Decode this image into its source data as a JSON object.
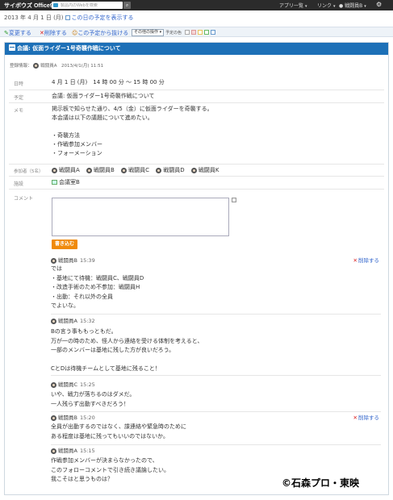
{
  "app": {
    "logo": "サイボウズ Office9"
  },
  "search": {
    "placeholder": "製品内のWebを検索"
  },
  "topmenu": {
    "apps": "アプリ一覧",
    "link": "リンク",
    "user": "戦闘員B"
  },
  "dateline": {
    "date": "2013 年 4 月 1 日 (月)",
    "show_link": "この日の予定を表示する"
  },
  "toolbar": {
    "edit": "変更する",
    "delete": "削除する",
    "leave": "この予定から抜ける",
    "other_ops": "その他の操作",
    "schedule_colors": "予定の色"
  },
  "colors": {
    "accent": "#1d70b7",
    "post_button": "#f08a0a",
    "link": "#3366cc",
    "delete_x": "#dd2222"
  },
  "event": {
    "title": "会議: 仮面ライダー1号奇襲作戦について",
    "reg_label": "登録情報：",
    "reg_user": "戦闘員A",
    "reg_time": "2013/4/1(月) 11:51",
    "date_label": "日時",
    "date_value": "4 月 1 日 (月)　14 時 00 分 〜 15 時 00 分",
    "plan_label": "予定",
    "plan_value": "会議: 仮面ライダー1号奇襲作戦について",
    "memo_label": "メモ",
    "memo_lines": [
      "掲示板で知らせた通り、4/5（金）に仮面ライダーを奇襲する。",
      "本会議は以下の議題について進めたい。",
      "",
      "・奇襲方法",
      "・作戦参加メンバー",
      "・フォーメーション"
    ],
    "participants_label": "参加者（5名）",
    "participants": [
      "戦闘員A",
      "戦闘員B",
      "戦闘員C",
      "戦闘員D",
      "戦闘員K"
    ],
    "facility_label": "施設",
    "facility": "会議室B",
    "comment_label": "コメント",
    "post_button": "書き込む"
  },
  "comments": [
    {
      "user": "戦闘員B",
      "time": "15:39",
      "deletable": true,
      "delete_label": "削除する",
      "lines": [
        "では",
        "・基地にて待機：戦闘員C、戦闘員D",
        "・改造手術のため不参加：戦闘員H",
        "・出動：それ以外の全員",
        "でよいな。"
      ]
    },
    {
      "user": "戦闘員A",
      "time": "15:32",
      "deletable": false,
      "delete_label": "",
      "lines": [
        "Bの言う事ももっともだ。",
        "万が一の時のため、怪人から連絡を受ける体制を考えると、",
        "一部のメンバーは基地に残した方が良いだろう。",
        "",
        "CとDは待機チームとして基地に残ること！"
      ]
    },
    {
      "user": "戦闘員C",
      "time": "15:25",
      "deletable": false,
      "delete_label": "",
      "lines": [
        "いや、戦力が落ちるのはダメだ。",
        "一人残らず出動すべきだろう！"
      ]
    },
    {
      "user": "戦闘員B",
      "time": "15:20",
      "deletable": true,
      "delete_label": "削除する",
      "lines": [
        "全員が出動するのではなく、諜連絡や緊急時のために",
        "ある程度は基地に残ってもいいのではないか。"
      ]
    },
    {
      "user": "戦闘員A",
      "time": "15:15",
      "deletable": false,
      "delete_label": "",
      "lines": [
        "作戦参加メンバーが決まらなかったので、",
        "このフォローコメントで引き続き議論したい。",
        "我こそはと思うものは？"
      ]
    }
  ],
  "watermark": "©石森プロ・東映"
}
